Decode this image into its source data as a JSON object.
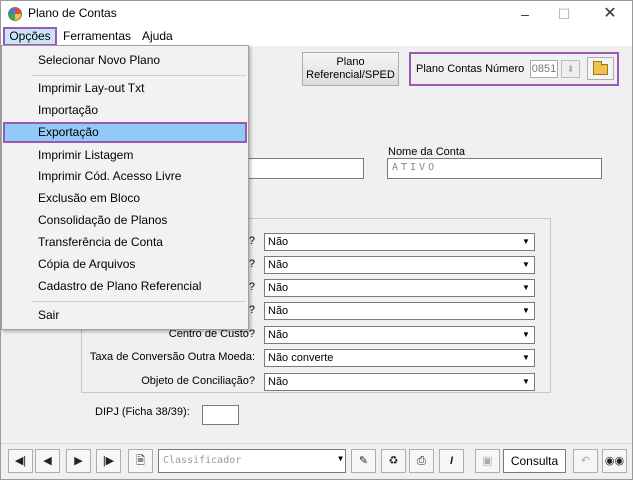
{
  "window": {
    "title": "Plano de Contas"
  },
  "menubar": {
    "items": [
      "Opções",
      "Ferramentas",
      "Ajuda"
    ]
  },
  "dropdown": {
    "items": [
      "Selecionar Novo Plano",
      "Imprimir Lay-out Txt",
      "Importação",
      "Exportação",
      "Imprimir Listagem",
      "Imprimir Cód. Acesso Livre",
      "Exclusão em Bloco",
      "Consolidação de Planos",
      "Transferência de Conta",
      "Cópia de Arquivos",
      "Cadastro de Plano Referencial",
      "Sair"
    ],
    "selected": "Exportação"
  },
  "header": {
    "referencial_button": "Plano Referencial/SPED",
    "plano_label": "Plano Contas Número",
    "plano_numero": "0851"
  },
  "form": {
    "nome_conta_label": "Nome da Conta",
    "nome_conta_value": "ATIVO",
    "rows": [
      {
        "label": "?",
        "value": "Não"
      },
      {
        "label": "?",
        "value": "Não"
      },
      {
        "label": "?",
        "value": "Não"
      },
      {
        "label": "?",
        "value": "Não"
      },
      {
        "label": "Centro de Custo?",
        "value": "Não"
      },
      {
        "label": "Taxa de Conversão Outra Moeda:",
        "value": "Não converte"
      },
      {
        "label": "Objeto de Conciliação?",
        "value": "Não"
      }
    ],
    "dipj_label": "DIPJ (Ficha 38/39):",
    "dipj_value": ""
  },
  "toolbar": {
    "classificador_placeholder": "Classificador",
    "consulta_label": "Consulta"
  }
}
